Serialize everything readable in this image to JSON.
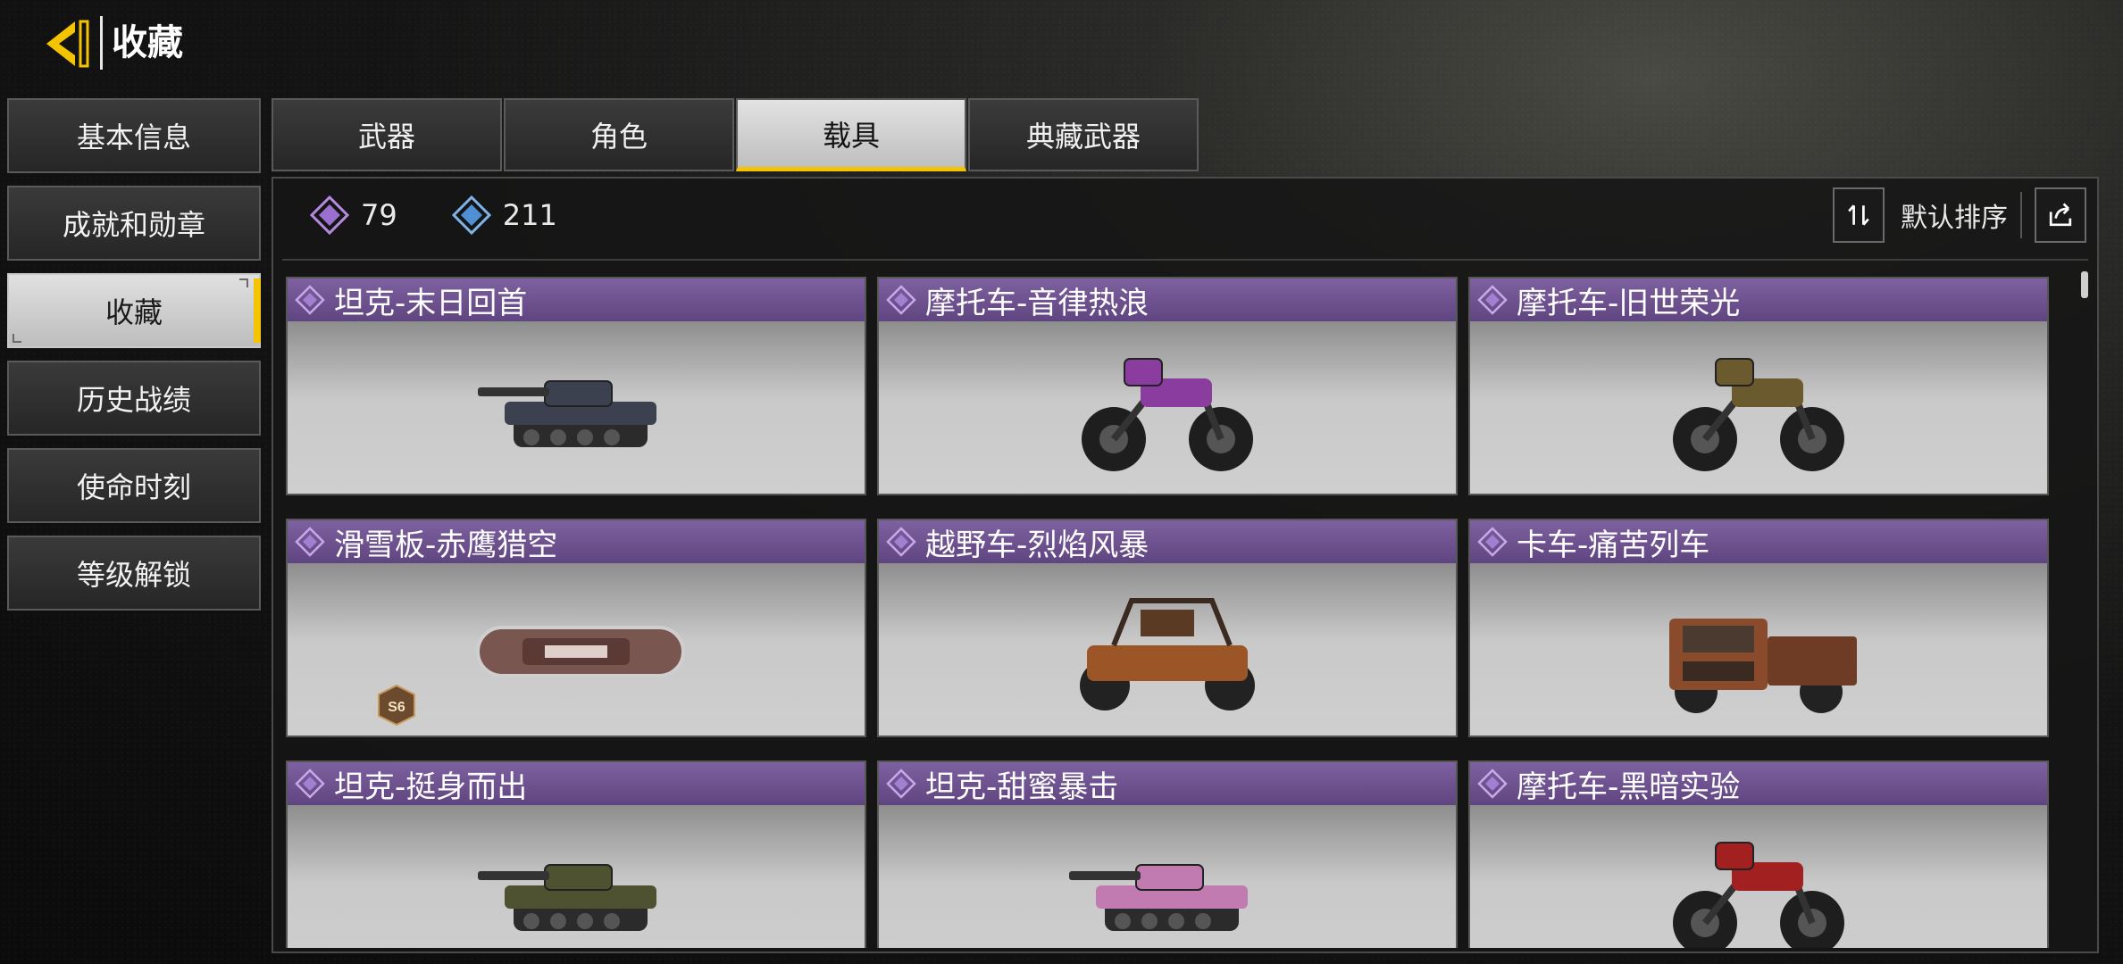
{
  "header": {
    "title": "收藏"
  },
  "sidebar": {
    "items": [
      {
        "label": "基本信息",
        "active": false
      },
      {
        "label": "成就和勋章",
        "active": false
      },
      {
        "label": "收藏",
        "active": true
      },
      {
        "label": "历史战绩",
        "active": false
      },
      {
        "label": "使命时刻",
        "active": false
      },
      {
        "label": "等级解锁",
        "active": false
      }
    ]
  },
  "tabs": [
    {
      "label": "武器",
      "active": false
    },
    {
      "label": "角色",
      "active": false
    },
    {
      "label": "载具",
      "active": true
    },
    {
      "label": "典藏武器",
      "active": false
    }
  ],
  "stats": {
    "purple_count": "79",
    "blue_count": "211"
  },
  "toolbar": {
    "sort_label": "默认排序"
  },
  "items": [
    {
      "name": "坦克-末日回首",
      "vehicle": "tank",
      "color": "#3c4150"
    },
    {
      "name": "摩托车-音律热浪",
      "vehicle": "motorcycle",
      "color": "#8a3d9e"
    },
    {
      "name": "摩托车-旧世荣光",
      "vehicle": "motorcycle",
      "color": "#6b5a2e"
    },
    {
      "name": "滑雪板-赤鹰猎空",
      "vehicle": "snowboard",
      "color": "#7a5650",
      "badge": "S6"
    },
    {
      "name": "越野车-烈焰风暴",
      "vehicle": "buggy",
      "color": "#9b5526"
    },
    {
      "name": "卡车-痛苦列车",
      "vehicle": "truck",
      "color": "#8a4a2c"
    },
    {
      "name": "坦克-挺身而出",
      "vehicle": "tank",
      "color": "#4e5230"
    },
    {
      "name": "坦克-甜蜜暴击",
      "vehicle": "tank",
      "color": "#c27bb0"
    },
    {
      "name": "摩托车-黑暗实验",
      "vehicle": "motorcycle",
      "color": "#a32020"
    }
  ],
  "colors": {
    "accent": "#f5c400",
    "card_header": "#6e5291"
  }
}
